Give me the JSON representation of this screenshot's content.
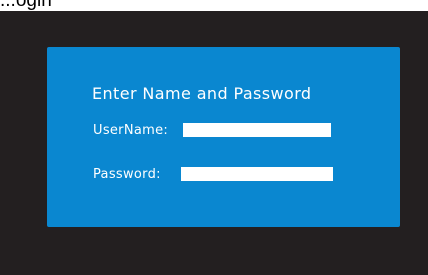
{
  "page": {
    "heading": "...ogin"
  },
  "dialog": {
    "title": "Enter Name and Password",
    "username": {
      "label": "UserName:",
      "value": "",
      "placeholder": ""
    },
    "password": {
      "label": "Password:",
      "value": "",
      "placeholder": ""
    }
  },
  "colors": {
    "screen_background": "#231f20",
    "dialog_background": "#0a87d0",
    "text": "#ffffff",
    "input_background": "#ffffff"
  }
}
